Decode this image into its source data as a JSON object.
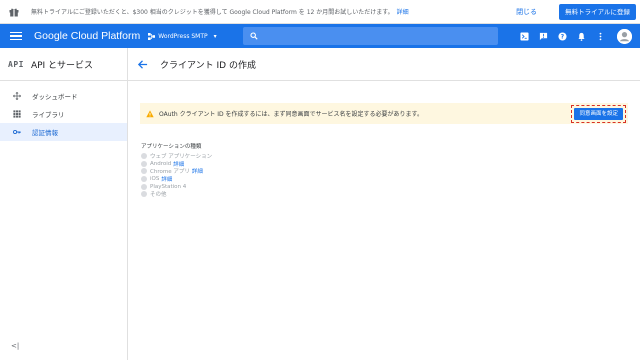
{
  "promo": {
    "text": "無料トライアルにご登録いただくと、$300 相当のクレジットを獲得して Google Cloud Platform を 12 か月間お試しいただけます。",
    "link": "詳細",
    "close_label": "閉じる",
    "cta_label": "無料トライアルに登録"
  },
  "header": {
    "brand": "Google Cloud Platform",
    "project": "WordPress SMTP",
    "icons": [
      "cloud-shell-icon",
      "alert-icon",
      "help-icon",
      "notifications-icon",
      "more-vert-icon",
      "account-icon"
    ]
  },
  "sidebar": {
    "api_logo": "API",
    "title": "API とサービス",
    "items": [
      {
        "label": "ダッシュボード",
        "icon": "dashboard-icon",
        "active": false
      },
      {
        "label": "ライブラリ",
        "icon": "library-icon",
        "active": false
      },
      {
        "label": "認証情報",
        "icon": "key-icon",
        "active": true
      }
    ],
    "collapse": "<|"
  },
  "main": {
    "title": "クライアント ID の作成",
    "warning": {
      "text": "OAuth クライアント ID を作成するには、まず同意画面でサービス名を設定する必要があります。",
      "button": "同意画面を設定"
    },
    "app_type": {
      "label": "アプリケーションの種類",
      "options": [
        {
          "label": "ウェブ アプリケーション",
          "link": ""
        },
        {
          "label": "Android",
          "link": "詳細"
        },
        {
          "label": "Chrome アプリ",
          "link": "詳細"
        },
        {
          "label": "iOS",
          "link": "詳細"
        },
        {
          "label": "PlayStation 4",
          "link": ""
        },
        {
          "label": "その他",
          "link": ""
        }
      ]
    }
  },
  "colors": {
    "primary": "#1a73e8",
    "warning_bg": "#fef7e0",
    "active_nav_bg": "#e8f0fe"
  }
}
